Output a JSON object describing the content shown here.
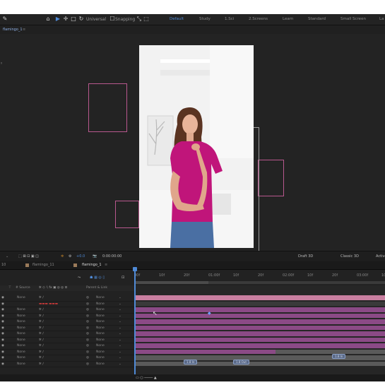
{
  "toolbar": {
    "snap_label": "Universal",
    "snapping_label": "Snapping",
    "workspaces": [
      "Default",
      "Study",
      "1.Sci",
      "2.Screens",
      "Learn",
      "Standard",
      "Small Screen",
      "La"
    ],
    "active_workspace": "Default"
  },
  "comp_tab": {
    "label": "flamingo_1"
  },
  "viewer": {
    "zoom": "+0.0",
    "timecode": "0:00:00:00",
    "renderer": "Draft 3D",
    "renderer_mode": "Classic 3D",
    "view": "Active"
  },
  "timeline_tabs": [
    {
      "label": "10"
    },
    {
      "label": "flamingo_11"
    },
    {
      "label": "flamingo_1"
    }
  ],
  "timeline": {
    "search_icon": "search-icon",
    "header_col_label": "Parent & Link",
    "source_col": "# Source",
    "ruler": [
      "00f",
      "10f",
      "20f",
      "01:00f",
      "10f",
      "20f",
      "02:00f",
      "10f",
      "20f",
      "03:00f",
      "10f"
    ],
    "layers": [
      {
        "parent": "None",
        "name": ""
      },
      {
        "parent": "None",
        "name": "red_line_label"
      },
      {
        "parent": "None",
        "name": ""
      },
      {
        "parent": "None",
        "name": ""
      },
      {
        "parent": "None",
        "name": ""
      },
      {
        "parent": "None",
        "name": ""
      },
      {
        "parent": "None",
        "name": ""
      },
      {
        "parent": "None",
        "name": ""
      },
      {
        "parent": "None",
        "name": ""
      },
      {
        "parent": "None",
        "name": ""
      },
      {
        "parent": "None",
        "name": ""
      },
      {
        "parent": "None",
        "name": ""
      }
    ],
    "keyframe_labels": [
      "1.8 In",
      "1.8 Out",
      "1.8 In"
    ]
  },
  "colors": {
    "accent": "#4f8ad6",
    "layer_bar": "#8b4a86",
    "frame_outline": "#b8588e",
    "shirt": "#c0157a"
  }
}
